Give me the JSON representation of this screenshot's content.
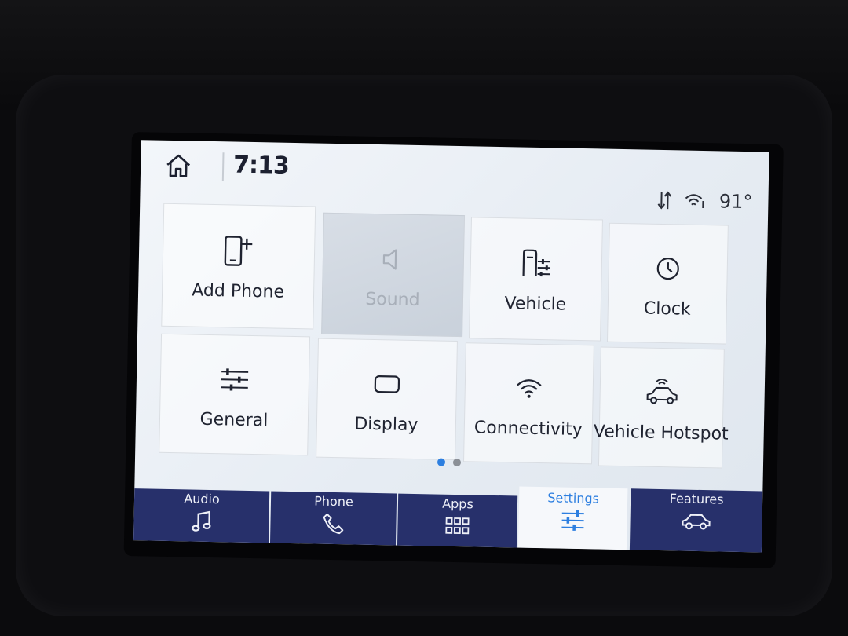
{
  "status": {
    "time": "7:13",
    "temperature": "91°"
  },
  "tiles": [
    {
      "label": "Add Phone",
      "icon": "add-phone-icon",
      "enabled": true
    },
    {
      "label": "Sound",
      "icon": "speaker-icon",
      "enabled": false
    },
    {
      "label": "Vehicle",
      "icon": "vehicle-settings-icon",
      "enabled": true
    },
    {
      "label": "Clock",
      "icon": "clock-icon",
      "enabled": true
    },
    {
      "label": "General",
      "icon": "sliders-icon",
      "enabled": true
    },
    {
      "label": "Display",
      "icon": "display-icon",
      "enabled": true
    },
    {
      "label": "Connectivity",
      "icon": "wifi-icon",
      "enabled": true
    },
    {
      "label": "Vehicle Hotspot",
      "icon": "hotspot-icon",
      "enabled": true
    }
  ],
  "pagination": {
    "pages": 2,
    "current": 1
  },
  "tabs": [
    {
      "label": "Audio",
      "icon": "music-note-icon",
      "active": false
    },
    {
      "label": "Phone",
      "icon": "phone-handset-icon",
      "active": false
    },
    {
      "label": "Apps",
      "icon": "app-grid-icon",
      "active": false
    },
    {
      "label": "Settings",
      "icon": "settings-sliders-icon",
      "active": true
    },
    {
      "label": "Features",
      "icon": "car-features-icon",
      "active": false
    }
  ],
  "colors": {
    "accent": "#2d7fe0",
    "tab_background": "#27306b",
    "screen_background": "#eef2f7"
  }
}
